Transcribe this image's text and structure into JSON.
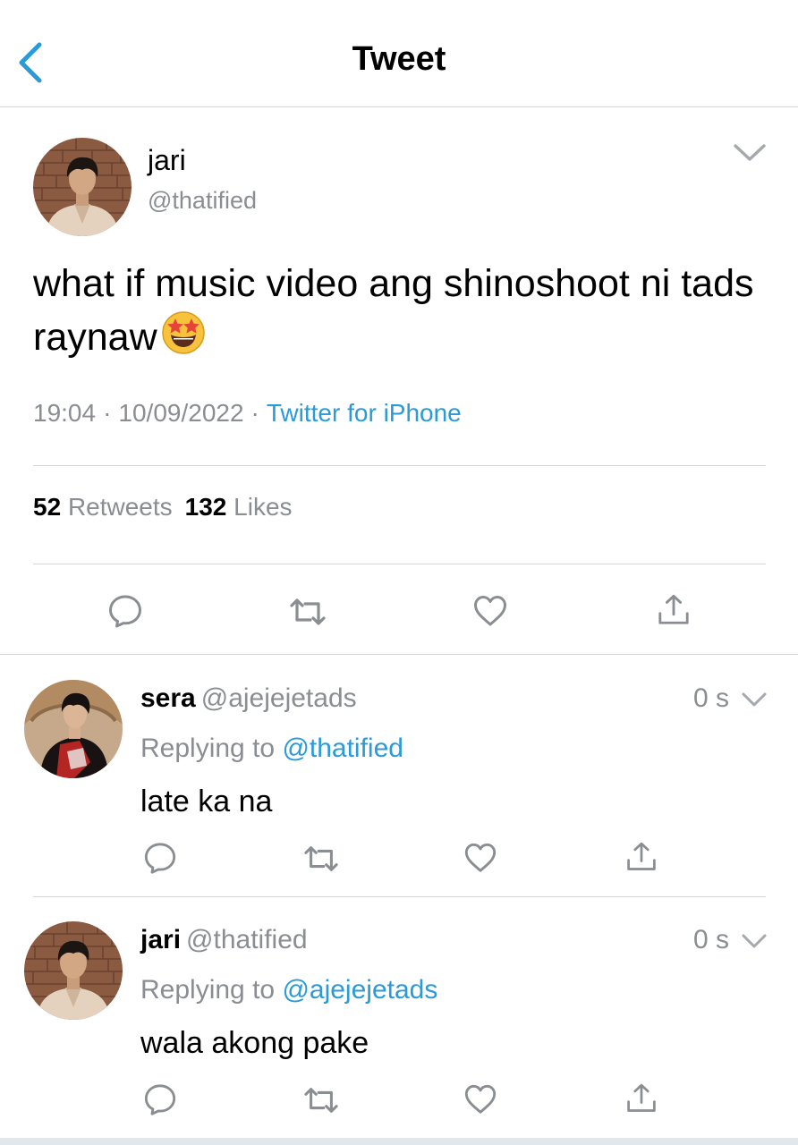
{
  "header": {
    "title": "Tweet"
  },
  "tweet": {
    "name": "jari",
    "handle": "@thatified",
    "text": "what if music video ang shinoshoot ni tads raynaw",
    "emoji": "star-struck",
    "time": "19:04",
    "date": "10/09/2022",
    "source": "Twitter for iPhone",
    "retweets_count": "52",
    "retweets_label": "Retweets",
    "likes_count": "132",
    "likes_label": "Likes"
  },
  "replies": [
    {
      "name": "sera",
      "handle": "@ajejejetads",
      "time": "0 s",
      "replying_label": "Replying to",
      "replying_to": "@thatified",
      "text": "late ka na"
    },
    {
      "name": "jari",
      "handle": "@thatified",
      "time": "0 s",
      "replying_label": "Replying to",
      "replying_to": "@ajejejetads",
      "text": "wala akong pake"
    }
  ],
  "colors": {
    "accent": "#2b9ad8",
    "muted": "#8a8d91",
    "divider": "#d3d6d9"
  },
  "icons": [
    "back-chevron-icon",
    "chevron-down-icon",
    "reply-icon",
    "retweet-icon",
    "like-icon",
    "share-icon"
  ]
}
